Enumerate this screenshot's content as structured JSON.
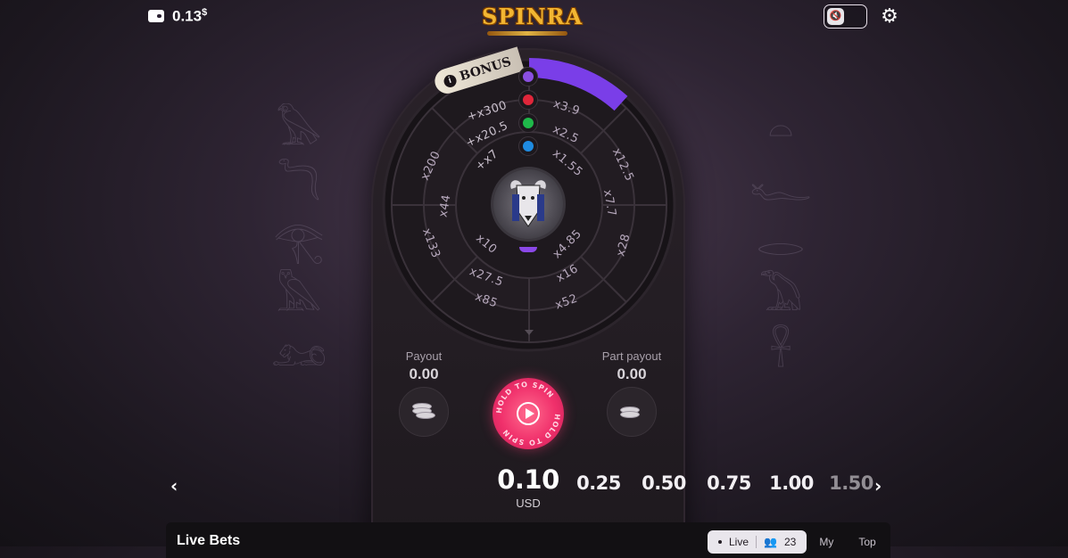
{
  "header": {
    "balance_amount": "0.13",
    "balance_currency": "$",
    "logo_text": "SPINRA"
  },
  "wheel": {
    "bonus_label": "BONUS",
    "outer_ring": [
      "x3.9",
      "x12.5",
      "x7.7",
      "x28",
      "x16",
      "x52",
      "x85",
      "x27.5",
      "x133",
      "x44",
      "x200"
    ],
    "middle_ring": [
      "+x300",
      "+x20.5",
      "+x7",
      "x2.5",
      "x1.55",
      "x4.85",
      "x10"
    ],
    "gems": [
      "purple",
      "red",
      "green",
      "blue"
    ],
    "gem_colors": {
      "purple": "#8a4fe0",
      "red": "#e0263a",
      "green": "#1fb84a",
      "blue": "#1f8be0"
    },
    "progress_color": "#7a3ee8"
  },
  "controls": {
    "payout_label": "Payout",
    "payout_value": "0.00",
    "part_payout_label": "Part payout",
    "part_payout_value": "0.00",
    "spin_text": "HOLD TO SPIN"
  },
  "bets": {
    "currency": "USD",
    "selected": "0.10",
    "options": [
      "0.25",
      "0.50",
      "0.75",
      "1.00",
      "1.50"
    ]
  },
  "live_bets": {
    "title": "Live Bets",
    "tab_live": "Live",
    "online_count": "23",
    "tab_my": "My",
    "tab_top": "Top"
  }
}
